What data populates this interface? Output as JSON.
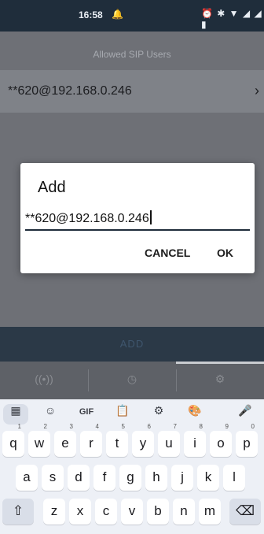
{
  "status": {
    "time": "16:58",
    "bell": "🔔",
    "icons": "⏰ ✱ ▼ ◢ ◢ ▮"
  },
  "app": {
    "title": "Allowed SIP Users",
    "row": {
      "text": "**620@192.168.0.246",
      "chevron": "›"
    },
    "add_button": "ADD",
    "tabs": [
      {
        "icon": "((•))"
      },
      {
        "icon": "◷"
      },
      {
        "icon": "⚙"
      }
    ]
  },
  "dialog": {
    "title": "Add",
    "input_value": "**620@192.168.0.246",
    "cancel": "CANCEL",
    "ok": "OK"
  },
  "keyboard": {
    "tools": [
      "▦",
      "☺",
      "GIF",
      "📋",
      "⚙",
      "🎨",
      "🎤"
    ],
    "row1": [
      {
        "k": "q",
        "n": "1"
      },
      {
        "k": "w",
        "n": "2"
      },
      {
        "k": "e",
        "n": "3"
      },
      {
        "k": "r",
        "n": "4"
      },
      {
        "k": "t",
        "n": "5"
      },
      {
        "k": "y",
        "n": "6"
      },
      {
        "k": "u",
        "n": "7"
      },
      {
        "k": "i",
        "n": "8"
      },
      {
        "k": "o",
        "n": "9"
      },
      {
        "k": "p",
        "n": "0"
      }
    ],
    "row2": [
      "a",
      "s",
      "d",
      "f",
      "g",
      "h",
      "j",
      "k",
      "l"
    ],
    "row3": [
      "z",
      "x",
      "c",
      "v",
      "b",
      "n",
      "m"
    ],
    "shift": "⇧",
    "backspace": "⌫"
  }
}
